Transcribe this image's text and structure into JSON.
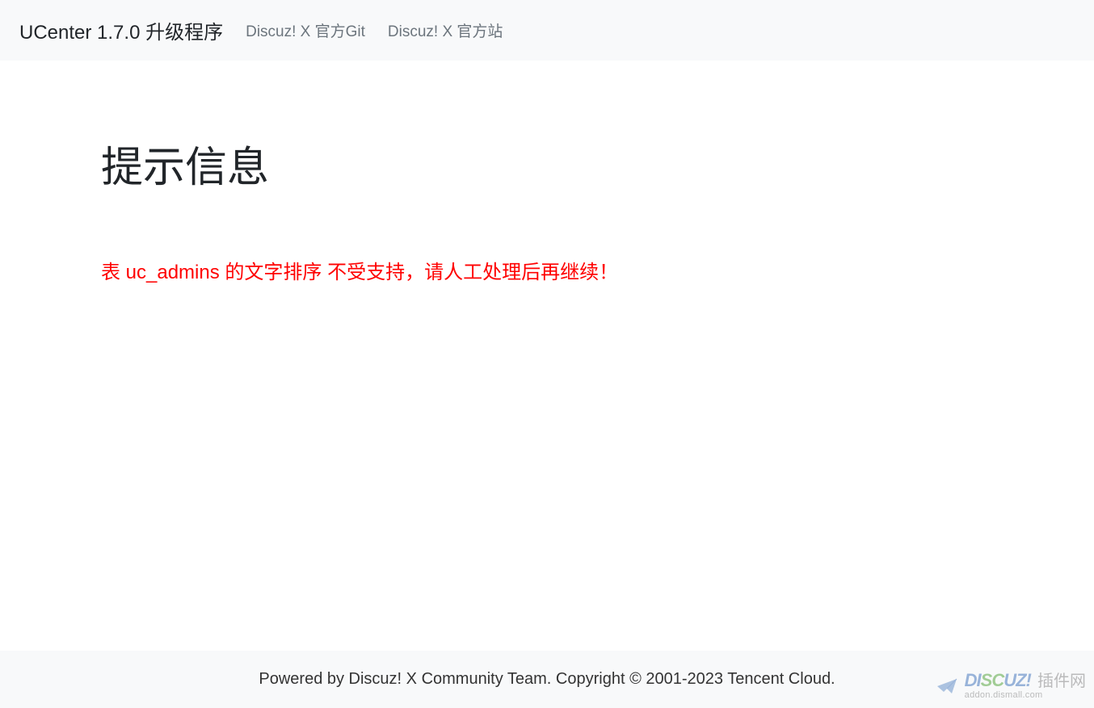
{
  "navbar": {
    "brand": "UCenter 1.7.0 升级程序",
    "links": [
      {
        "label": "Discuz! X 官方Git"
      },
      {
        "label": "Discuz! X 官方站"
      }
    ]
  },
  "main": {
    "title": "提示信息",
    "error_message": "表 uc_admins 的文字排序 不受支持，请人工处理后再继续！"
  },
  "footer": {
    "text": "Powered by Discuz! X Community Team. Copyright © 2001-2023 Tencent Cloud."
  },
  "watermark": {
    "text_main": "DISCUZ!",
    "text_cn": "插件网",
    "url": "addon.dismall.com"
  }
}
